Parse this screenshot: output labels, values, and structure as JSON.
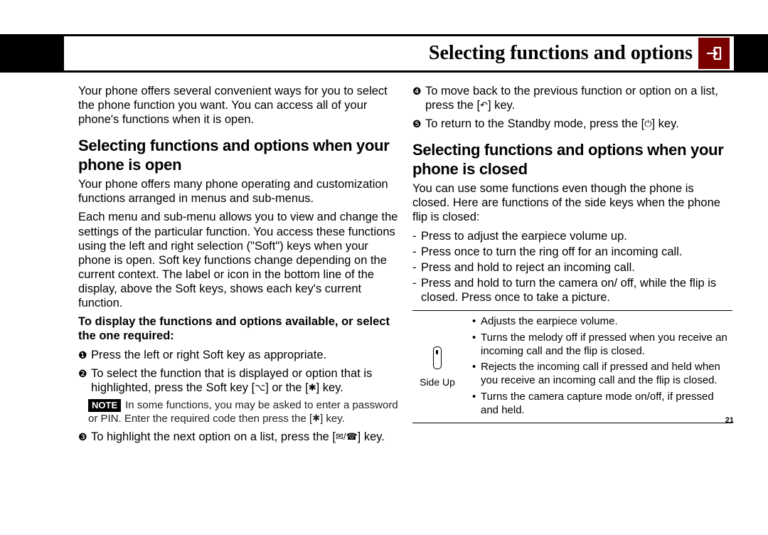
{
  "header": {
    "title": "Selecting functions and options"
  },
  "left": {
    "intro": "Your phone offers several convenient ways for you to select the phone function you want. You can access all of your phone's functions when it is open.",
    "h1": "Selecting functions and options when your phone is open",
    "p1": "Your phone offers many phone operating and customization functions arranged in menus and sub-menus.",
    "p2": "Each menu and sub-menu allows you to view and change the settings of the particular function. You access these functions using the left and right selection (\"Soft\") keys when your phone is open. Soft key functions change depending on the current context. The label or icon in the bottom line of the display, above the Soft keys, shows each key's current function.",
    "lead": "To display the functions and options available, or select the one required:",
    "steps": {
      "s1": "Press the left or right Soft key as appropriate.",
      "s2_a": "To select the function that is displayed or option that is highlighted, press the Soft key [",
      "s2_b": "] or the [",
      "s2_c": "] key.",
      "note_a": "In some functions, you may be asked to enter a password or PIN. Enter the required code then press the [",
      "note_b": "] key.",
      "s3_a": "To highlight the next option on a list, press the [",
      "s3_b": "] key."
    }
  },
  "right": {
    "s4_a": "To move back to the previous function or option on a list, press the [",
    "s4_b": "] key.",
    "s5_a": "To return to the Standby mode, press the [",
    "s5_b": "] key.",
    "h1": "Selecting functions and options when your phone is closed",
    "p1": "You can use some functions even though the phone is closed. Here are functions of the side keys when the phone flip is closed:",
    "d1": "Press to adjust the earpiece volume up.",
    "d2": "Press once to turn the ring off for an incoming call.",
    "d3": "Press and hold to reject an incoming call.",
    "d4": "Press and hold to turn the camera on/ off, while the flip is closed. Press once to take a picture.",
    "side_label": "Side Up",
    "b1": "Adjusts the earpiece volume.",
    "b2": "Turns the melody off if pressed when you receive an incoming call and the flip is closed.",
    "b3": "Rejects the incoming call if pressed and held when you receive an incoming call and the flip is closed.",
    "b4": "Turns the camera capture mode on/off, if pressed and held."
  },
  "page_number": "21",
  "note_label": "NOTE"
}
